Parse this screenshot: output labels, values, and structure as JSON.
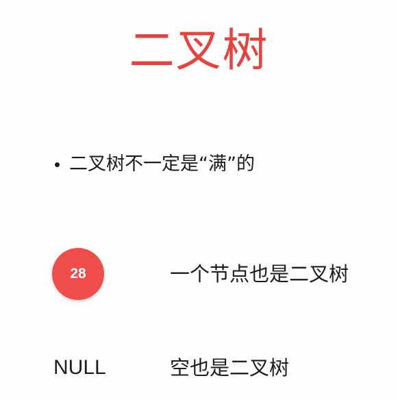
{
  "title": "二叉树",
  "bullet": "二叉树不一定是“满”的",
  "examples": [
    {
      "node_value": "28",
      "caption": "一个节点也是二叉树"
    },
    {
      "label": "NULL",
      "caption": "空也是二叉树"
    }
  ],
  "colors": {
    "accent": "#e8423f",
    "node_fill": "#ee4d4a",
    "text": "#1c1c1c",
    "background": "#fdfdfd"
  }
}
